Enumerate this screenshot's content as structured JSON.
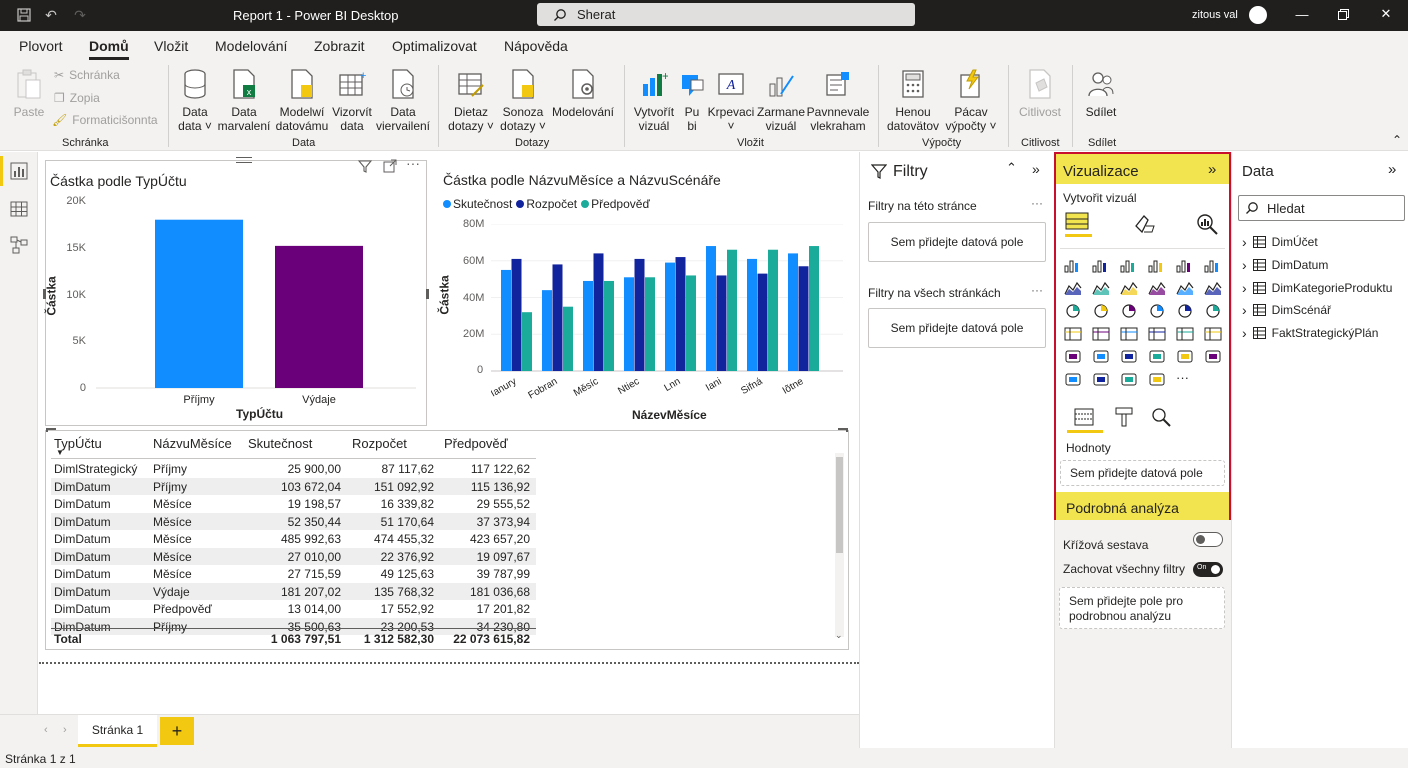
{
  "titlebar": {
    "title": "Report 1 - Power BI Desktop",
    "search_text": "Sherat",
    "user_name": "zitous val"
  },
  "ribbon_tabs": [
    "Plovort",
    "Domů",
    "Vložit",
    "Modelování",
    "Zobrazit",
    "Optimalizovat",
    "Nápověda"
  ],
  "ribbon": {
    "paste": "Paste",
    "clipboard_items": [
      "Schránka",
      "Zopia",
      "Formaticišonnta"
    ],
    "groups": {
      "clipboard": "Schránka",
      "data": "Data",
      "queries": "Dotazy",
      "insert": "Vložit",
      "calculations": "Výpočty",
      "sensitivity": "Citlivost",
      "share": "Sdílet"
    },
    "buttons": {
      "get_data": [
        "Data",
        "data"
      ],
      "data_recent": [
        "Data",
        "marvalení"
      ],
      "model": [
        "Modelwí",
        "datovámu"
      ],
      "create_data": [
        "Vizorvít",
        "data"
      ],
      "data_refresh": [
        "Data",
        "viervailení"
      ],
      "transform": [
        "Dietaz",
        "dotazy"
      ],
      "refresh": [
        "Sonoza",
        "dotazy"
      ],
      "modeling": [
        "Modelování",
        ""
      ],
      "new_visual": [
        "Vytvořít",
        "vizuál"
      ],
      "pubi": [
        "Pu",
        "bi"
      ],
      "textbox": [
        "Krpevaci",
        ""
      ],
      "more_visuals": [
        "Zarmane",
        "vizuál"
      ],
      "smart": [
        "Pavnnevale",
        "vlekraham"
      ],
      "new_measure": [
        "Henou",
        "datovätov"
      ],
      "quick_measure": [
        "Pácav",
        "výpočty"
      ],
      "sensitivity": [
        "Citlivost",
        ""
      ],
      "share": [
        "Sdílet",
        ""
      ]
    }
  },
  "bar_chart": {
    "title": "Částka podle TypÚčtu",
    "xlabel": "TypÚčtu",
    "ylabel": "Částka",
    "ticks": [
      "20K",
      "15K",
      "10K",
      "5K",
      "0"
    ]
  },
  "col_chart": {
    "title": "Částka podle NázvuMěsíce a NázvuScénáře",
    "xlabel": "NázevMěsíce",
    "ylabel": "Částka",
    "ticks": [
      "80M",
      "60M",
      "40M",
      "20M",
      "0"
    ]
  },
  "chart_data": [
    {
      "type": "bar",
      "title": "Částka podle TypÚčtu",
      "xlabel": "TypÚčtu",
      "ylabel": "Částka",
      "categories": [
        "Příjmy",
        "Výdaje"
      ],
      "values": [
        18000,
        15200
      ],
      "colors": [
        "#118dff",
        "#6b007b"
      ],
      "ylim": [
        0,
        20000
      ]
    },
    {
      "type": "bar",
      "title": "Částka podle NázvuMěsíce a NázvuScénáře",
      "xlabel": "NázevMěsíce",
      "ylabel": "Částka",
      "legend": "top-left",
      "categories": [
        "Ianury",
        "Fobran",
        "Měsíc",
        "Ntiec",
        "Lnn",
        "Iani",
        "Sifná",
        "Iõtne"
      ],
      "series": [
        {
          "name": "Skutečnost",
          "color": "#118dff",
          "values": [
            55,
            44,
            49,
            51,
            59,
            68,
            61,
            64
          ]
        },
        {
          "name": "Rozpočet",
          "color": "#12239e",
          "values": [
            61,
            58,
            64,
            61,
            62,
            52,
            53,
            57
          ]
        },
        {
          "name": "Předpověď",
          "color": "#1aab9b",
          "values": [
            32,
            35,
            49,
            51,
            52,
            66,
            66,
            68
          ]
        }
      ],
      "ylim": [
        0,
        80
      ]
    }
  ],
  "table": {
    "headers": [
      "TypÚčtu",
      "NázvuMěsíce",
      "Skutečnost",
      "Rozpočet",
      "Předpověď"
    ],
    "rows": [
      [
        "DimlStrategický",
        "Příjmy",
        "25 900,00",
        "87 117,62",
        "117 122,62"
      ],
      [
        "DimDatum",
        "Příjmy",
        "103 672,04",
        "151 092,92",
        "115 136,92"
      ],
      [
        "DimDatum",
        "Měsíce",
        "19 198,57",
        "16 339,82",
        "29 555,52"
      ],
      [
        "DimDatum",
        "Měsíce",
        "52 350,44",
        "51 170,64",
        "37 373,94"
      ],
      [
        "DimDatum",
        "Měsíce",
        "485 992,63",
        "474 455,32",
        "423 657,20"
      ],
      [
        "DimDatum",
        "Měsíce",
        "27 010,00",
        "22 376,92",
        "19 097,67"
      ],
      [
        "DimDatum",
        "Měsíce",
        "27 715,59",
        "49 125,63",
        "39 787,99"
      ],
      [
        "DimDatum",
        "Výdaje",
        "181 207,02",
        "135 768,32",
        "181 036,68"
      ],
      [
        "DimDatum",
        "Předpověď",
        "13 014,00",
        "17 552,92",
        "17 201,82"
      ],
      [
        "DimDatum",
        "Příjmy",
        "35 500,63",
        "23 200,53",
        "34 230,80"
      ]
    ],
    "total": [
      "Total",
      "1 063 797,51",
      "1 312 582,30",
      "22 073 615,82"
    ]
  },
  "pages": {
    "page1": "Stránka 1",
    "add": "+"
  },
  "status": "Stránka 1 z 1",
  "filters": {
    "title": "Filtry",
    "this_page": "Filtry na této stránce",
    "this_page_well": "Sem přidejte datová pole",
    "all_pages": "Filtry na všech stránkách",
    "all_pages_well": "Sem přidejte datová pole",
    "more": "···"
  },
  "viz": {
    "title": "Vizualizace",
    "build": "Vytvořit vizuál",
    "values": "Hodnoty",
    "values_well": "Sem přidejte datová pole",
    "drill": "Podrobná analýza",
    "cross_report": "Křížová sestava",
    "keep_filters": "Zachovat všechny filtry",
    "keep_toggle": "On",
    "drill_well": "Sem přidejte pole pro podrobnou analýzu",
    "more": "···"
  },
  "data_pane": {
    "title": "Data",
    "search_placeholder": "Hledat",
    "tables": [
      "DimÚčet",
      "DimDatum",
      "DimKategorieProduktu",
      "DimScénář",
      "FaktStrategickýPlán"
    ]
  },
  "colors": {
    "accent_yellow": "#f2e44e",
    "highlight_red": "#c8102e",
    "titlebar": "#201f1e"
  }
}
